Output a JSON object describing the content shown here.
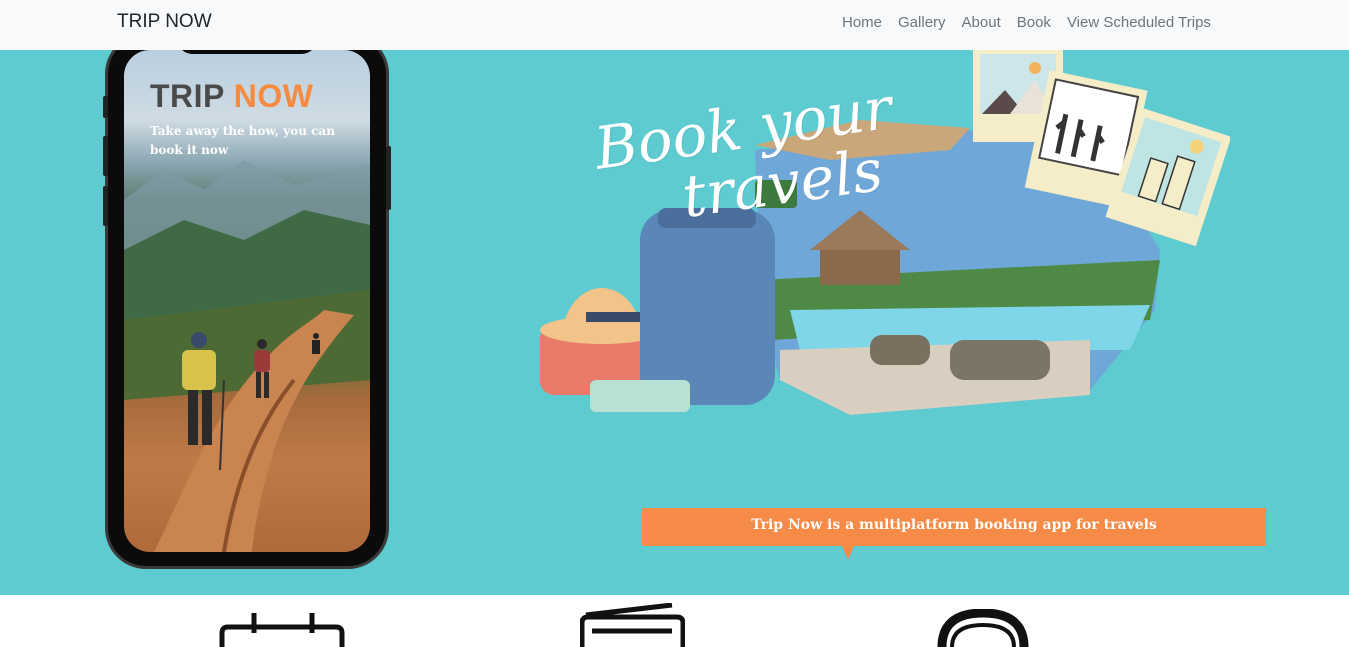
{
  "navbar": {
    "brand": "TRIP NOW",
    "links": [
      "Home",
      "Gallery",
      "About",
      "Book",
      "View Scheduled Trips"
    ]
  },
  "hero": {
    "phone": {
      "app_title_part1": "TRIP ",
      "app_title_part2": "NOW",
      "tagline": "Take away the how, you can book it now"
    },
    "headline_line1": "Book your",
    "headline_line2": "travels",
    "banner": "Trip Now is a multiplatform booking app for travels"
  },
  "features": {
    "icons": [
      "calendar-icon",
      "ticket-icon",
      "headset-icon"
    ]
  },
  "colors": {
    "hero_bg": "#5ecbd0",
    "accent": "#f68b48",
    "navbar_bg": "#f8f9fa"
  }
}
